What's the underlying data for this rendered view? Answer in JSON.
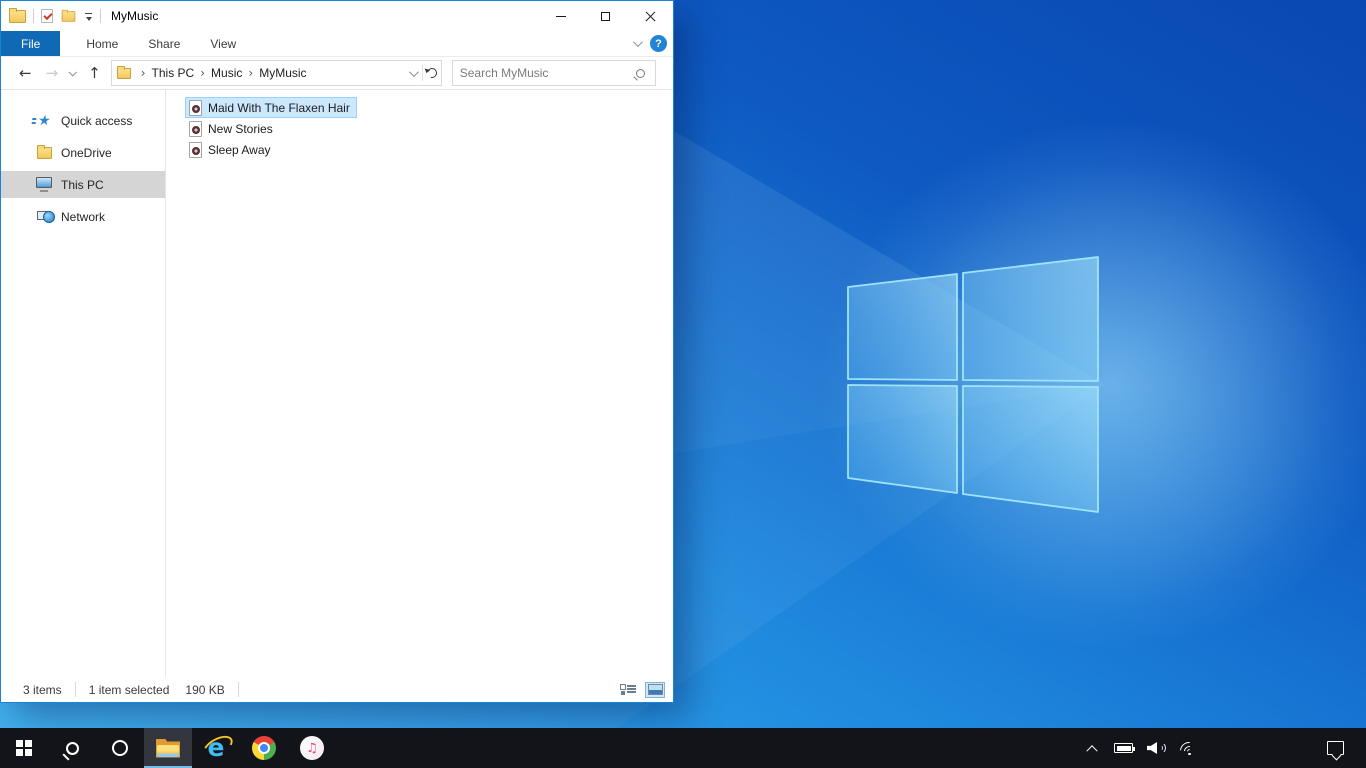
{
  "colors": {
    "accent": "#0078d7",
    "window_border": "#1883d7",
    "file_tab_bg": "#0f69b4",
    "selection_fill": "#cce8ff",
    "selection_border": "#99d1ff",
    "sidebar_selected": "#d5d5d5",
    "taskbar_bg": "#131419",
    "taskbar_active_underline": "#76b9ed"
  },
  "desktop": {
    "wallpaper": "windows-10-light-blue-logo"
  },
  "explorer": {
    "title": "MyMusic",
    "quick_access_toolbar": {
      "window_icon": "folder-icon",
      "buttons": [
        "properties-icon",
        "new-folder-icon",
        "customize-quick-access-chevron-icon"
      ]
    },
    "window_buttons": [
      "minimize",
      "maximize",
      "close"
    ],
    "ribbon": {
      "tabs": [
        {
          "label": "File",
          "active": true
        },
        {
          "label": "Home",
          "active": false
        },
        {
          "label": "Share",
          "active": false
        },
        {
          "label": "View",
          "active": false
        }
      ],
      "expand_icon": "chevron-down-icon",
      "help_icon": "help-icon"
    },
    "navigation": {
      "back_icon": "back-arrow-icon",
      "forward_icon": "forward-arrow-icon",
      "recent_locations_icon": "chevron-down-icon",
      "up_icon": "up-arrow-icon",
      "address_icon": "folder-icon",
      "address_dropdown_icon": "chevron-down-icon",
      "refresh_icon": "refresh-icon",
      "breadcrumb": [
        {
          "label": "This PC"
        },
        {
          "label": "Music"
        },
        {
          "label": "MyMusic"
        }
      ],
      "search_placeholder": "Search MyMusic",
      "search_icon": "search-icon"
    },
    "sidebar": {
      "items": [
        {
          "label": "Quick access",
          "icon": "quick-access-star-icon",
          "selected": false
        },
        {
          "label": "OneDrive",
          "icon": "onedrive-folder-icon",
          "selected": false
        },
        {
          "label": "This PC",
          "icon": "this-pc-monitor-icon",
          "selected": true
        },
        {
          "label": "Network",
          "icon": "network-icon",
          "selected": false
        }
      ]
    },
    "files": {
      "items": [
        {
          "name": "Maid With The Flaxen Hair",
          "icon": "audio-file-icon",
          "selected": true
        },
        {
          "name": "New Stories",
          "icon": "audio-file-icon",
          "selected": false
        },
        {
          "name": "Sleep Away",
          "icon": "audio-file-icon",
          "selected": false
        }
      ]
    },
    "status_bar": {
      "item_count": "3 items",
      "selection": "1 item selected",
      "selection_size": "190 KB",
      "view_toggles": [
        "details-view-icon",
        "large-icons-view-icon"
      ],
      "active_view": "large-icons-view"
    }
  },
  "taskbar": {
    "items": [
      {
        "name": "start",
        "icon": "windows-start-icon",
        "active": false
      },
      {
        "name": "search",
        "icon": "search-icon",
        "active": false
      },
      {
        "name": "cortana",
        "icon": "cortana-icon",
        "active": false
      },
      {
        "name": "file-explorer",
        "icon": "file-explorer-icon",
        "active": true
      },
      {
        "name": "internet-explorer",
        "icon": "internet-explorer-icon",
        "active": false
      },
      {
        "name": "chrome",
        "icon": "chrome-icon",
        "active": false
      },
      {
        "name": "itunes",
        "icon": "itunes-icon",
        "active": false
      }
    ],
    "tray": [
      "hidden-icons-chevron-icon",
      "battery-icon",
      "volume-icon",
      "wifi-icon",
      "action-center-icon"
    ]
  }
}
